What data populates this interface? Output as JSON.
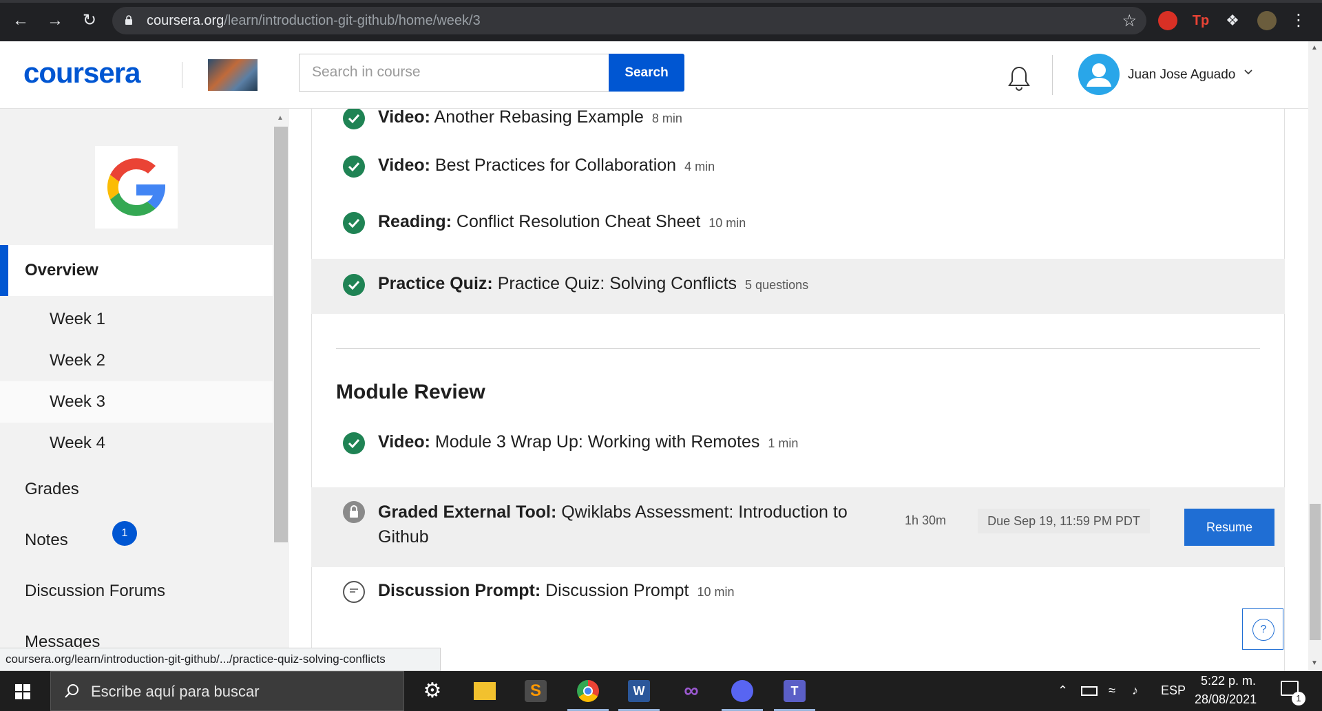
{
  "browser": {
    "url_host": "coursera.org",
    "url_path": "/learn/introduction-git-github/home/week/3"
  },
  "header": {
    "logo_text": "coursera",
    "search_placeholder": "Search in course",
    "search_button": "Search",
    "user_name": "Juan Jose Aguado"
  },
  "sidebar": {
    "overview": "Overview",
    "weeks": [
      "Week 1",
      "Week 2",
      "Week 3",
      "Week 4"
    ],
    "grades": "Grades",
    "notes": "Notes",
    "forums": "Discussion Forums",
    "messages": "Messages",
    "messages_count": "1"
  },
  "main": {
    "items_top": [
      {
        "type": "Video:",
        "title": "Another Rebasing Example",
        "meta": "8 min"
      },
      {
        "type": "Video:",
        "title": "Best Practices for Collaboration",
        "meta": "4 min"
      },
      {
        "type": "Reading:",
        "title": "Conflict Resolution Cheat Sheet",
        "meta": "10 min"
      },
      {
        "type": "Practice Quiz:",
        "title": "Practice Quiz: Solving Conflicts",
        "meta": "5 questions"
      }
    ],
    "section_title": "Module Review",
    "review_video": {
      "type": "Video:",
      "title": "Module 3 Wrap Up: Working with Remotes",
      "meta": "1 min"
    },
    "graded": {
      "type": "Graded External Tool:",
      "title_line1": "Qwiklabs Assessment: Introduction to",
      "title_line2": "Github",
      "duration": "1h 30m",
      "due": "Due Sep 19, 11:59 PM PDT",
      "button": "Resume"
    },
    "discussion": {
      "type": "Discussion Prompt:",
      "title": "Discussion Prompt",
      "meta": "10 min"
    },
    "help": "?"
  },
  "status_url": "coursera.org/learn/introduction-git-github/.../practice-quiz-solving-conflicts",
  "taskbar": {
    "search_placeholder": "Escribe aquí para buscar",
    "lang": "ESP",
    "time": "5:22 p. m.",
    "date": "28/08/2021",
    "notifications": "1"
  },
  "colors": {
    "brand": "#0056d2",
    "check": "#1f8354",
    "resume": "#1f6ed4"
  }
}
